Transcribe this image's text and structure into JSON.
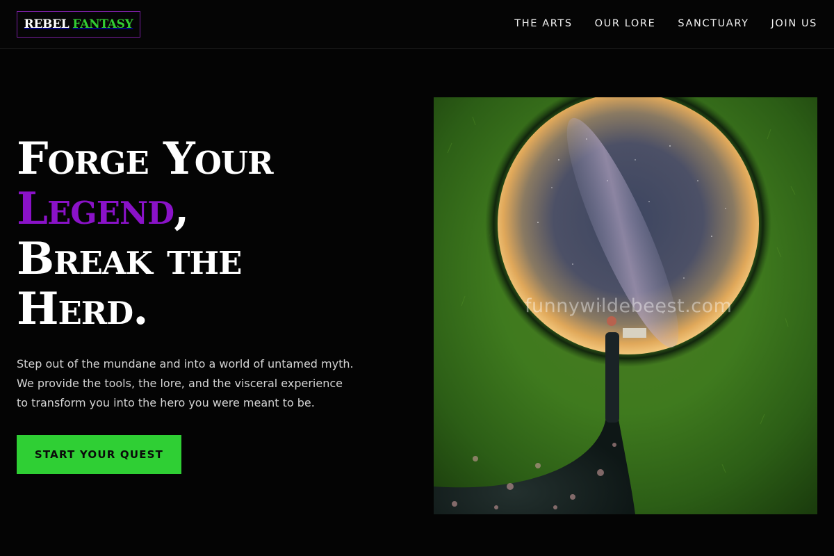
{
  "header": {
    "logo": {
      "word1": "REBEL",
      "word2": "FANTASY"
    },
    "nav": [
      "THE ARTS",
      "OUR LORE",
      "SANCTUARY",
      "JOIN US"
    ]
  },
  "hero": {
    "headline": {
      "line1": "Forge Your",
      "line2_accent": "Legend",
      "line2_tail": ",",
      "line3": "Break the",
      "line4": "Herd."
    },
    "intro": [
      "Step out of the mundane and into a world of untamed myth.",
      "We provide the tools, the lore, and the visceral experience",
      "to transform you into the hero you were meant to be."
    ],
    "cta_label": "START YOUR QUEST",
    "image_watermark": "funnywildebeest.com"
  },
  "colors": {
    "background": "#040404",
    "accent_purple": "#8a12c8",
    "accent_green": "#2fcf34",
    "logo_border": "#7a1fa2"
  }
}
